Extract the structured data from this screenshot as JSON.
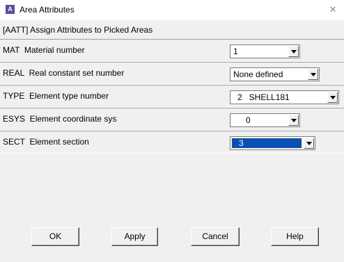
{
  "window": {
    "app_icon_letter": "A",
    "title": "Area Attributes"
  },
  "command": "[AATT]  Assign Attributes to Picked Areas",
  "fields": [
    {
      "label": "MAT  Material number",
      "value": "1"
    },
    {
      "label": "REAL  Real constant set number",
      "value": "None defined"
    },
    {
      "label": "TYPE  Element type number",
      "value": "2   SHELL181"
    },
    {
      "label": "ESYS  Element coordinate sys",
      "value": "0"
    },
    {
      "label": "SECT  Element section",
      "value": "3"
    }
  ],
  "buttons": {
    "ok": "OK",
    "apply": "Apply",
    "cancel": "Cancel",
    "help": "Help"
  },
  "colors": {
    "selection": "#0a4fb5",
    "app_icon": "#5c4a9e"
  },
  "icons": {
    "close": "close-icon",
    "dropdown": "chevron-down-icon"
  }
}
